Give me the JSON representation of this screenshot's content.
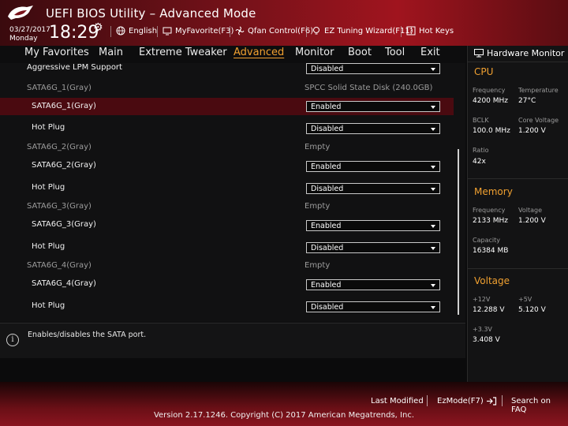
{
  "header": {
    "title": "UEFI BIOS Utility – Advanced Mode",
    "date": "03/27/2017",
    "day": "Monday",
    "time": "18:29",
    "items": [
      {
        "label": "English",
        "icon": "globe-icon"
      },
      {
        "label": "MyFavorite(F3)",
        "icon": "favorite-monitor-icon"
      },
      {
        "label": "Qfan Control(F6)",
        "icon": "fan-icon"
      },
      {
        "label": "EZ Tuning Wizard(F11)",
        "icon": "bulb-icon"
      },
      {
        "label": "Hot Keys",
        "icon": "hotkeys-icon"
      }
    ]
  },
  "menu": {
    "items": [
      "My Favorites",
      "Main",
      "Extreme Tweaker",
      "Advanced",
      "Monitor",
      "Boot",
      "Tool",
      "Exit"
    ],
    "active": "Advanced"
  },
  "settings": {
    "top_label": "Aggressive LPM Support",
    "top_value": "Disabled",
    "ports": [
      {
        "group": "SATA6G_1(Gray)",
        "info": "SPCC Solid State Disk (240.0GB)",
        "port_label": "SATA6G_1(Gray)",
        "port_value": "Enabled",
        "hotplug_label": "Hot Plug",
        "hotplug_value": "Disabled"
      },
      {
        "group": "SATA6G_2(Gray)",
        "info": "Empty",
        "port_label": "SATA6G_2(Gray)",
        "port_value": "Enabled",
        "hotplug_label": "Hot Plug",
        "hotplug_value": "Disabled"
      },
      {
        "group": "SATA6G_3(Gray)",
        "info": "Empty",
        "port_label": "SATA6G_3(Gray)",
        "port_value": "Enabled",
        "hotplug_label": "Hot Plug",
        "hotplug_value": "Disabled"
      },
      {
        "group": "SATA6G_4(Gray)",
        "info": "Empty",
        "port_label": "SATA6G_4(Gray)",
        "port_value": "Enabled",
        "hotplug_label": "Hot Plug",
        "hotplug_value": "Disabled"
      }
    ]
  },
  "help": {
    "text": "Enables/disables the SATA port."
  },
  "hardware_monitor": {
    "title": "Hardware Monitor",
    "cpu": {
      "heading": "CPU",
      "frequency_label": "Frequency",
      "frequency": "4200 MHz",
      "temperature_label": "Temperature",
      "temperature": "27°C",
      "bclk_label": "BCLK",
      "bclk": "100.0 MHz",
      "core_voltage_label": "Core Voltage",
      "core_voltage": "1.200 V",
      "ratio_label": "Ratio",
      "ratio": "42x"
    },
    "memory": {
      "heading": "Memory",
      "frequency_label": "Frequency",
      "frequency": "2133 MHz",
      "voltage_label": "Voltage",
      "voltage": "1.200 V",
      "capacity_label": "Capacity",
      "capacity": "16384 MB"
    },
    "voltage": {
      "heading": "Voltage",
      "v12_label": "+12V",
      "v12": "12.288 V",
      "v5_label": "+5V",
      "v5": "5.120 V",
      "v33_label": "+3.3V",
      "v33": "3.408 V"
    }
  },
  "footer": {
    "last_modified": "Last Modified",
    "ezmode": "EzMode(F7)",
    "search": "Search on FAQ",
    "version": "Version 2.17.1246. Copyright (C) 2017 American Megatrends, Inc."
  },
  "colors": {
    "accent": "#f0a030",
    "highlight_row": "#4a0a10",
    "header_red": "#a0141e"
  }
}
